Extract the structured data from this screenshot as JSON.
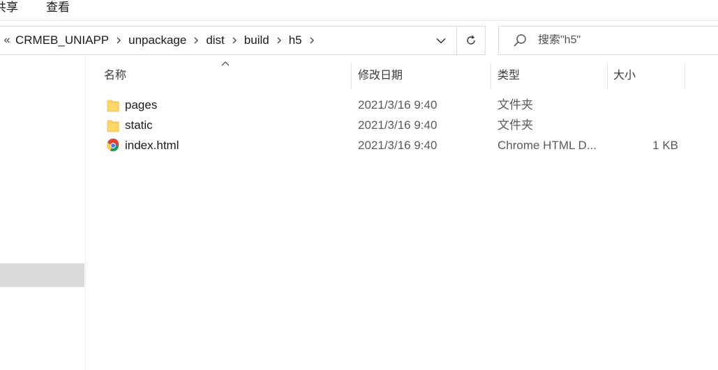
{
  "ribbon": {
    "tabs": [
      {
        "label": "共享"
      },
      {
        "label": "查看"
      }
    ]
  },
  "address": {
    "overflow": "«",
    "crumbs": [
      "CRMEB_UNIAPP",
      "unpackage",
      "dist",
      "build",
      "h5"
    ],
    "dropdown_icon": "chevron-down-icon",
    "refresh_icon": "refresh-icon"
  },
  "search": {
    "placeholder": "搜索\"h5\"",
    "icon": "search-icon"
  },
  "columns": {
    "name": "名称",
    "date": "修改日期",
    "type": "类型",
    "size": "大小"
  },
  "files": [
    {
      "name": "pages",
      "date": "2021/3/16 9:40",
      "type": "文件夹",
      "size": "",
      "icon": "folder-icon"
    },
    {
      "name": "static",
      "date": "2021/3/16 9:40",
      "type": "文件夹",
      "size": "",
      "icon": "folder-icon"
    },
    {
      "name": "index.html",
      "date": "2021/3/16 9:40",
      "type": "Chrome HTML D...",
      "size": "1 KB",
      "icon": "chrome-icon"
    }
  ],
  "colors": {
    "folder": "#ffd766",
    "selection": "#d9d9d9",
    "border": "#d9d9d9"
  }
}
